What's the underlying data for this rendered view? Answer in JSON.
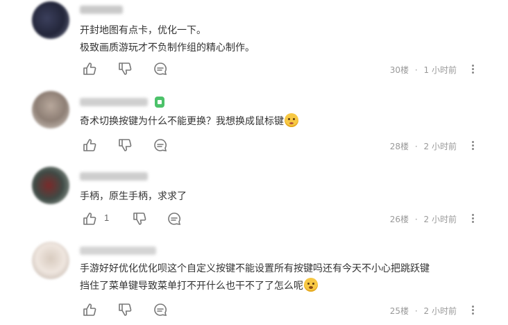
{
  "comments": [
    {
      "lines": [
        "开封地图有点卡，优化一下。",
        "极致画质游玩才不负制作组的精心制作。"
      ],
      "floor": "30楼",
      "time": "1 小时前",
      "likes": ""
    },
    {
      "lines": [
        "奇术切换按键为什么不能更换？我想换成鼠标键"
      ],
      "emoji": "sad-face-emoji",
      "floor": "28楼",
      "time": "2 小时前",
      "likes": ""
    },
    {
      "lines": [
        "手柄，原生手柄，求求了"
      ],
      "floor": "26楼",
      "time": "2 小时前",
      "likes": "1"
    },
    {
      "lines": [
        "手游好好优化优化呗这个自定义按键不能设置所有按键吗还有今天不小心把跳跃键",
        "挡住了菜单键导致菜单打不开什么也干不了了怎么呢"
      ],
      "emoji": "puzzled-face-emoji",
      "floor": "25楼",
      "time": "2 小时前",
      "likes": ""
    }
  ],
  "meta_separator": "·",
  "colors": {
    "text": "#333333",
    "meta": "#999999",
    "icon": "#777777",
    "badge": "#4cc26a"
  }
}
